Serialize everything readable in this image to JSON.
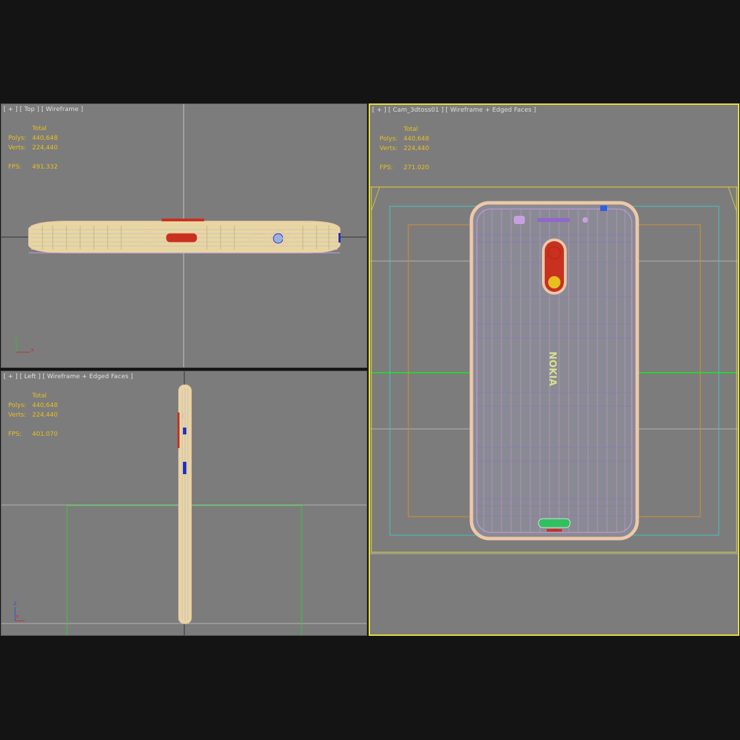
{
  "viewports": {
    "top": {
      "label": "[ + ] [ Top ] [ Wireframe ]",
      "stats": {
        "total_label": "Total",
        "polys_label": "Polys:",
        "polys": "440,648",
        "verts_label": "Verts:",
        "verts": "224,440",
        "fps_label": "FPS:",
        "fps": "491.332"
      },
      "axes": {
        "vertical": "y",
        "horizontal": "x"
      }
    },
    "left": {
      "label": "[ + ] [ Left ] [ Wireframe + Edged Faces ]",
      "stats": {
        "total_label": "Total",
        "polys_label": "Polys:",
        "polys": "440,648",
        "verts_label": "Verts:",
        "verts": "224,440",
        "fps_label": "FPS:",
        "fps": "401.070"
      },
      "axes": {
        "vertical": "z",
        "horizontal": "x"
      }
    },
    "camera": {
      "label": "[ + ] [ Cam_3dtoss01 ] [ Wireframe + Edged Faces ]",
      "stats": {
        "total_label": "Total",
        "polys_label": "Polys:",
        "polys": "440,648",
        "verts_label": "Verts:",
        "verts": "224,440",
        "fps_label": "FPS:",
        "fps": "271.020"
      },
      "logo_text": "NOKIA"
    }
  },
  "colors": {
    "viewport_bg": "#7c7c7c",
    "app_bg": "#141414",
    "active_border": "#e6e13c",
    "stats_text": "#e8c020",
    "label_text": "#e0e0e0",
    "wire_body": "#eec8a8",
    "wire_inner": "#c8a0e0",
    "wire_purple": "#9068c8",
    "camera_red": "#c83020",
    "safe_frame_yellow": "#d8c830",
    "safe_frame_cyan": "#40c8c8",
    "safe_frame_orange": "#d89030",
    "grid_green": "#30d030"
  }
}
